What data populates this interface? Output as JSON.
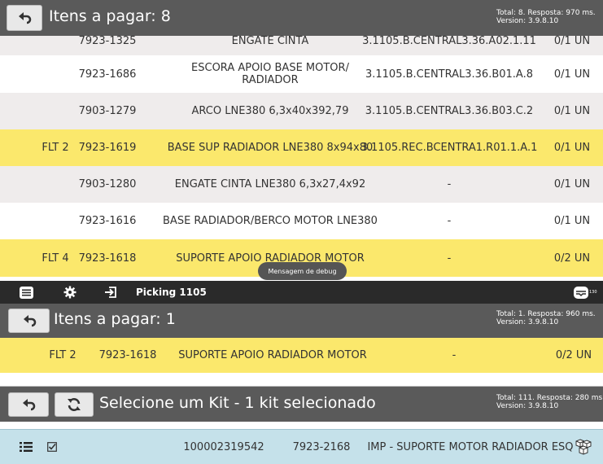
{
  "panel1": {
    "title": "Itens a pagar: 8",
    "info_total": "Total: 8. Resposta: 970 ms.",
    "info_version": "Version: 3.9.8.10",
    "partial_row": {
      "code": "7923-1325",
      "desc": "ENGATE CINTA",
      "loc": "3.1105.B.CENTRAL3.36.A02.1.11",
      "qty": "0/1 UN"
    },
    "rows": [
      {
        "flt": "",
        "code": "7923-1686",
        "desc": "ESCORA APOIO BASE MOTOR/ RADIADOR",
        "loc": "3.1105.B.CENTRAL3.36.B01.A.8",
        "qty": "0/1 UN",
        "style": "white"
      },
      {
        "flt": "",
        "code": "7903-1279",
        "desc": "ARCO LNE380 6,3x40x392,79",
        "loc": "3.1105.B.CENTRAL3.36.B03.C.2",
        "qty": "0/1 UN",
        "style": "grey"
      },
      {
        "flt": "FLT 2",
        "code": "7923-1619",
        "desc": "BASE SUP RADIADOR LNE380 8x94x80",
        "loc": "3.1105.REC.BCENTRA1.R01.1.A.1",
        "qty": "0/1 UN",
        "style": "yellow"
      },
      {
        "flt": "",
        "code": "7903-1280",
        "desc": "ENGATE CINTA LNE380 6,3x27,4x92",
        "loc": "-",
        "qty": "0/1 UN",
        "style": "grey"
      },
      {
        "flt": "",
        "code": "7923-1616",
        "desc": "BASE RADIADOR/BERCO MOTOR LNE380",
        "loc": "-",
        "qty": "0/1 UN",
        "style": "white"
      },
      {
        "flt": "FLT 4",
        "code": "7923-1618",
        "desc": "SUPORTE APOIO RADIADOR MOTOR",
        "loc": "-",
        "qty": "0/2 UN",
        "style": "yellow"
      }
    ],
    "toast": "Mensagem de debug"
  },
  "navbar": {
    "title": "Picking 1105",
    "badge": "130",
    "icons": [
      "list-icon",
      "settings-gear-icon",
      "login-arrow-icon",
      "inbox-icon"
    ]
  },
  "panel2": {
    "title": "Itens a pagar: 1",
    "info_total": "Total: 1. Resposta: 960 ms.",
    "info_version": "Version: 3.9.8.10",
    "row": {
      "flt": "FLT 2",
      "code": "7923-1618",
      "desc": "SUPORTE APOIO RADIADOR MOTOR",
      "loc": "-",
      "qty": "0/2 UN"
    }
  },
  "panel3": {
    "title": "Selecione um Kit - 1 kit selecionado",
    "info_total": "Total: 111. Resposta: 280 ms.",
    "info_version": "Version: 3.9.8.10",
    "row": {
      "number": "100002319542",
      "code": "7923-2168",
      "desc": "IMP - SUPORTE MOTOR RADIADOR ESQ"
    }
  },
  "colors": {
    "header": "#5a5a5a",
    "row_white": "#ffffff",
    "row_grey": "#efecec",
    "row_yellow": "#fbe86c",
    "row_blue": "#c5e1ea",
    "navbar": "#2a2a2a"
  }
}
